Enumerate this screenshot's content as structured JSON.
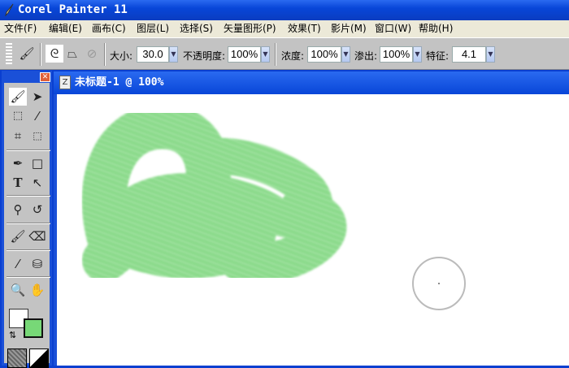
{
  "app": {
    "title": "Corel Painter 11"
  },
  "menu": [
    "文件(F)",
    "编辑(E)",
    "画布(C)",
    "图层(L)",
    "选择(S)",
    "矢量图形(P)",
    "效果(T)",
    "影片(M)",
    "窗口(W)",
    "帮助(H)"
  ],
  "props": {
    "size_label": "大小:",
    "size_value": "30.0",
    "opacity_label": "不透明度:",
    "opacity_value": "100%",
    "density_label": "浓度:",
    "density_value": "100%",
    "bleed_label": "渗出:",
    "bleed_value": "100%",
    "feature_label": "特征:",
    "feature_value": "4.1"
  },
  "document": {
    "title": "未标题-1 @ 100%"
  },
  "colors": {
    "main_color": "#ffffff",
    "additional_color": "#77d877",
    "stroke": "#85d985"
  }
}
